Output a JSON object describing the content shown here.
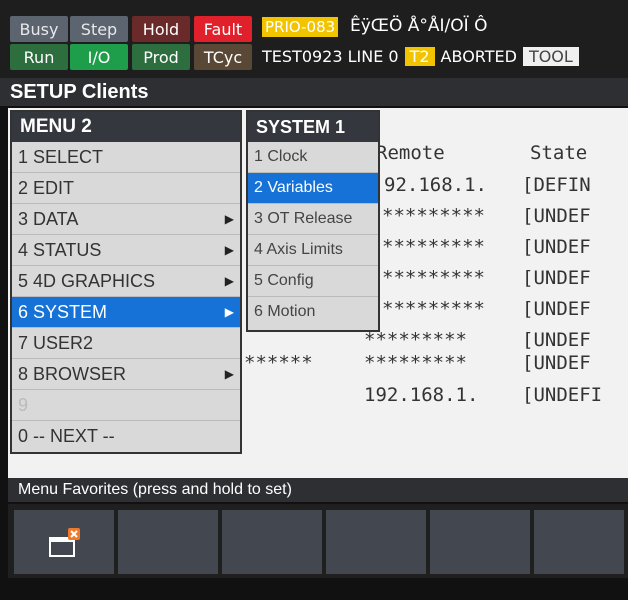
{
  "status": {
    "buttons": [
      {
        "label": "Busy",
        "color": "#5c6470"
      },
      {
        "label": "Step",
        "color": "#5c6470"
      },
      {
        "label": "Hold",
        "color": "#6a2a2a"
      },
      {
        "label": "Fault",
        "color": "#e0202a"
      },
      {
        "label": "Run",
        "color": "#2c6e3e"
      },
      {
        "label": "I/O",
        "color": "#1e9e4a"
      },
      {
        "label": "Prod",
        "color": "#2c6e3e"
      },
      {
        "label": "TCyc",
        "color": "#5a4836"
      }
    ],
    "prio": "PRIO-083",
    "garbled": "ÊÿŒÖ Å°ÅI/OÏ  Ô",
    "program": "TEST0923 LINE 0",
    "t2": "T2",
    "state": "ABORTED",
    "tool": "TOOL"
  },
  "screen_title": "SETUP Clients",
  "content": {
    "remote_header": "Remote",
    "state_header": "State",
    "rows": [
      {
        "remote": "92.168.1.",
        "state": "[DEFIN"
      },
      {
        "remote": "*********",
        "state": "[UNDEF"
      },
      {
        "remote": "*********",
        "state": "[UNDEF"
      },
      {
        "remote": "*********",
        "state": "[UNDEF"
      },
      {
        "remote": "*********",
        "state": "[UNDEF"
      },
      {
        "remote": "*********",
        "state": "[UNDEF"
      },
      {
        "remote": "*********",
        "state": "[UNDEF"
      },
      {
        "remote": "192.168.1.",
        "state": "[UNDEFI"
      }
    ],
    "left_stars": "******"
  },
  "menu2": {
    "title": "MENU  2",
    "items": [
      {
        "label": "1 SELECT",
        "arrow": false
      },
      {
        "label": "2 EDIT",
        "arrow": false
      },
      {
        "label": "3 DATA",
        "arrow": true
      },
      {
        "label": "4 STATUS",
        "arrow": true
      },
      {
        "label": "5 4D GRAPHICS",
        "arrow": true
      },
      {
        "label": "6 SYSTEM",
        "arrow": true,
        "selected": true
      },
      {
        "label": "7 USER2",
        "arrow": false
      },
      {
        "label": "8 BROWSER",
        "arrow": true
      },
      {
        "label": "9",
        "arrow": false
      },
      {
        "label": "0 -- NEXT --",
        "arrow": false
      }
    ]
  },
  "system1": {
    "title": "SYSTEM  1",
    "items": [
      {
        "label": "1 Clock"
      },
      {
        "label": "2 Variables",
        "selected": true
      },
      {
        "label": "3 OT Release"
      },
      {
        "label": "4 Axis Limits"
      },
      {
        "label": "5 Config"
      },
      {
        "label": "6 Motion"
      }
    ]
  },
  "favorites": {
    "label": "Menu Favorites (press and hold to set)",
    "icon": "window-close-icon"
  }
}
